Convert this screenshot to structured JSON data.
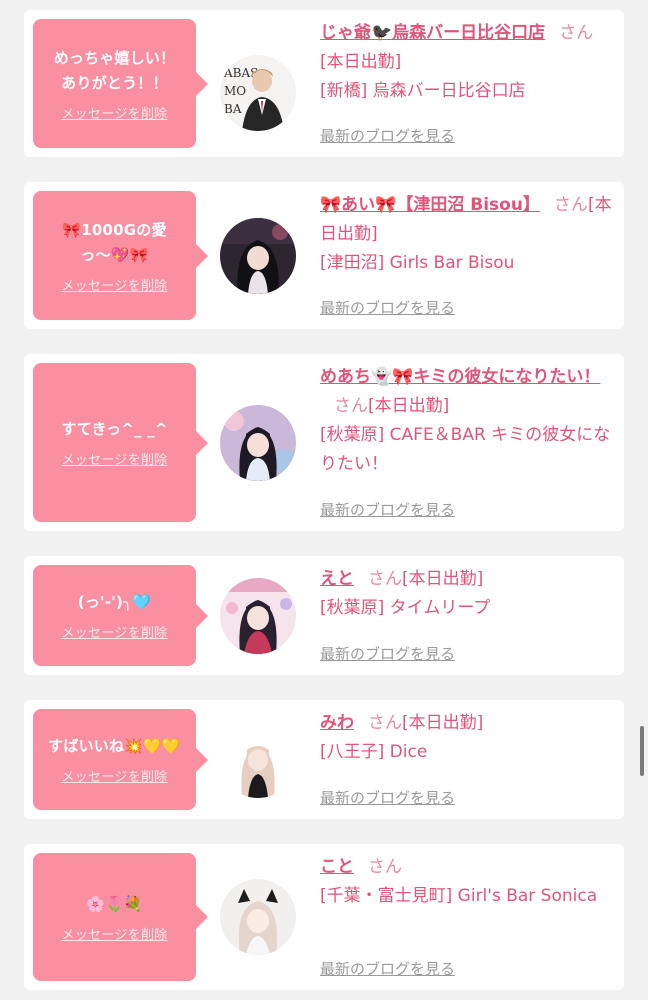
{
  "delete_label": "メッセージを削除",
  "blog_label": "最新のブログを見る",
  "san": "さん",
  "accent": "#fa8fa1",
  "entries": [
    {
      "message": "めっちゃ嬉しい！\nありがとう！！",
      "name": "じゃ爺🐦‍⬛烏森バー日比谷口店",
      "status": "[本日出勤]",
      "store": "[新橋] 烏森バー日比谷口店"
    },
    {
      "message": "🎀1000Gの愛っ〜💖🎀",
      "name": "🎀あい🎀【津田沼 Bisou】",
      "status": "[本日出勤]",
      "store": "[津田沼] Girls Bar Bisou"
    },
    {
      "message": "すてきっ^_ _^",
      "name": "めあち👻🎀キミの彼女になりたい！",
      "status": "[本日出勤]",
      "store": "[秋葉原] CAFE＆BAR キミの彼女になりたい！"
    },
    {
      "message": "(っ'-')╮🩵",
      "name": "えと",
      "status": "[本日出勤]",
      "store": "[秋葉原] タイムリープ"
    },
    {
      "message": "すばいいね💥💛💛",
      "name": "みわ",
      "status": "[本日出勤]",
      "store": "[八王子] Dice"
    },
    {
      "message": "🌸🌷💐",
      "name": "こと",
      "status": "",
      "store": "[千葉・富士見町] Girl's Bar Sonica"
    }
  ]
}
